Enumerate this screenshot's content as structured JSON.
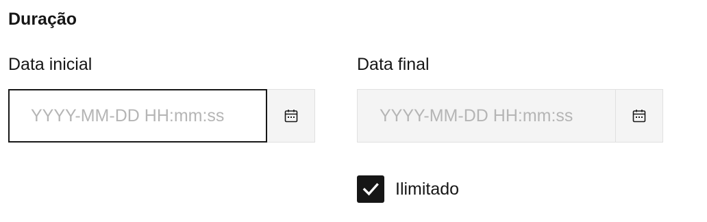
{
  "section": {
    "title": "Duração"
  },
  "start_date": {
    "label": "Data inicial",
    "value": "",
    "placeholder": "YYYY-MM-DD HH:mm:ss",
    "icon": "calendar-icon"
  },
  "end_date": {
    "label": "Data final",
    "value": "",
    "placeholder": "YYYY-MM-DD HH:mm:ss",
    "icon": "calendar-icon"
  },
  "unlimited": {
    "label": "Ilimitado",
    "checked": true,
    "icon": "checkmark-icon"
  },
  "colors": {
    "text": "#161616",
    "field_background": "#f4f4f4",
    "field_border": "#e0e0e0",
    "focus_border": "#161616",
    "placeholder": "#b5b5b5",
    "checkbox_fill": "#161616"
  }
}
